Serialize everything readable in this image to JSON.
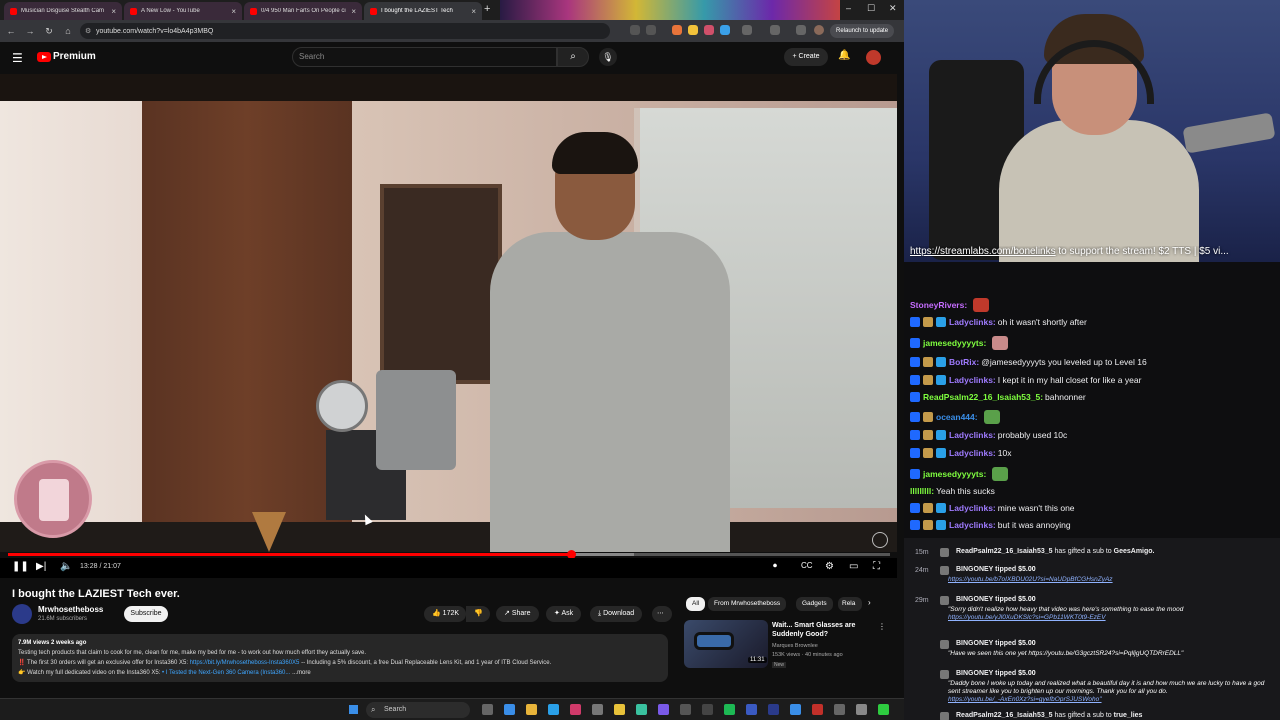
{
  "browser": {
    "tabs": [
      {
        "title": "Musician Disguise Stealth Cam"
      },
      {
        "title": "A New Low - YouTube"
      },
      {
        "title": "0/4 950 Man Farts On People ci"
      },
      {
        "title": "I bought the LAZIEST Tech"
      }
    ],
    "url": "youtube.com/watch?v=lo4bA4p3MBQ",
    "relaunch_label": "Relaunch to update"
  },
  "youtube": {
    "brand": "Premium",
    "search_placeholder": "Search",
    "create_label": "Create",
    "player": {
      "time": "13:28 / 21:07",
      "played_fraction": 0.638,
      "buffered_fraction": 0.71
    },
    "video_title": "I bought the LAZIEST Tech ever.",
    "channel": {
      "name": "Mrwhosetheboss",
      "subscribers": "21.6M subscribers"
    },
    "subscribe_label": "Subscribe",
    "actions": {
      "likes": "172K",
      "share": "Share",
      "ask": "Ask",
      "download": "Download"
    },
    "description": {
      "meta": "7.9M views  2 weeks ago",
      "line1": "Testing tech products that claim to cook for me, clean for me, make my bed for me - to work out how much effort they actually save.",
      "line2a": "‼️ The first 30 orders will get an exclusive offer for Insta360 X5: ",
      "line2link": "https://bit.ly/Mrwhosetheboss-Insta360X5",
      "line2b": " -- Including a 5% discount, a free Dual Replaceable Lens Kit, and 1 year of ITB Cloud Service.",
      "line3a": "👉 Watch my full dedicated video on the Insta360 X5: ",
      "line3b": "• I Tested the Next-Gen 360 Camera (Insta360...",
      "more": "...more"
    },
    "chips": [
      "All",
      "From Mrwhosetheboss",
      "Gadgets",
      "Rela"
    ],
    "recommendation": {
      "title": "Wait... Smart Glasses are Suddenly Good?",
      "channel": "Marques Brownlee",
      "stats": "153K views · 40 minutes ago",
      "badge": "New",
      "duration": "11:31"
    }
  },
  "stream": {
    "ticker_link": "https://streamlabs.com/bonelinks",
    "ticker_text": " to support the stream! $2 TTS | $5 vi..."
  },
  "chat": [
    {
      "user": "StoneyRivers:",
      "text": "",
      "color": "#c56cff",
      "badges": 0,
      "emote": "#c0392b"
    },
    {
      "user": "Ladyclinks:",
      "text": "oh it wasn't shortly after",
      "color": "#9f7bff",
      "badges": 3
    },
    {
      "user": "jamesedyyyyts:",
      "text": "",
      "color": "#7fff3f",
      "badges": 1,
      "emote": "#c88a8a"
    },
    {
      "user": "BotRix:",
      "text": "@jamesedyyyyts you leveled up to Level 16",
      "color": "#9f7bff",
      "badges": 3
    },
    {
      "user": "Ladyclinks:",
      "text": "I kept it in my hall closet for like a year",
      "color": "#9f7bff",
      "badges": 3
    },
    {
      "user": "ReadPsalm22_16_Isaiah53_5:",
      "text": "bahnonner",
      "color": "#7fff3f",
      "badges": 1
    },
    {
      "user": "ocean444:",
      "text": "",
      "color": "#3a8ee8",
      "badges": 2,
      "emote": "#5aa04a"
    },
    {
      "user": "Ladyclinks:",
      "text": "probably used 10c",
      "color": "#9f7bff",
      "badges": 3
    },
    {
      "user": "Ladyclinks:",
      "text": "10x",
      "color": "#9f7bff",
      "badges": 3
    },
    {
      "user": "jamesedyyyyts:",
      "text": "",
      "color": "#7fff3f",
      "badges": 1,
      "emote": "#5aa04a"
    },
    {
      "user": "lllllllll:",
      "text": "Yeah this sucks",
      "color": "#7fff3f",
      "badges": 0
    },
    {
      "user": "Ladyclinks:",
      "text": "mine wasn't this one",
      "color": "#9f7bff",
      "badges": 3
    },
    {
      "user": "Ladyclinks:",
      "text": "but it was annoying",
      "color": "#9f7bff",
      "badges": 3
    }
  ],
  "events": [
    {
      "time": "15m",
      "user": "ReadPsalm22_16_Isaiah53_5",
      "action": " has gifted a sub to ",
      "target": "GeesAmigo."
    },
    {
      "time": "24m",
      "user": "BINGONEY",
      "amount": "$5.00",
      "url": "https://youtu.be/b7oIXBDU02U?si=NaUDpBfCGHsnZyAz"
    },
    {
      "time": "29m",
      "user": "BINGONEY",
      "amount": "$5.00",
      "body": "\"Sorry didn't realize how heavy that video was here's something to ease the mood",
      "url": "https://youtu.be/yJl0XuDKSlc?si=GPb11WKT0t9-EzEV"
    },
    {
      "time": "",
      "user": "BINGONEY",
      "amount": "$5.00",
      "body": "\"Have we seen this one yet https://youtu.be/G3gcztSR24?si=PqlljgUQTDRrEDLL\""
    },
    {
      "time": "",
      "user": "BINGONEY",
      "amount": "$5.00",
      "body": "\"Daddy bone I woke up today and realized what a beautiful day it is and how much we are lucky to have a god sent streamer like you to brighten up our mornings. Thank you for all you do.",
      "url": "https://youtu.be/_-AxEn0Xz?si=gyefbOprSJUSWoho\""
    },
    {
      "time": "",
      "user": "ReadPsalm22_16_Isaiah53_5",
      "action": " has gifted a sub to ",
      "target": "true_lies"
    }
  ],
  "taskbar": {
    "search_placeholder": "Search"
  }
}
